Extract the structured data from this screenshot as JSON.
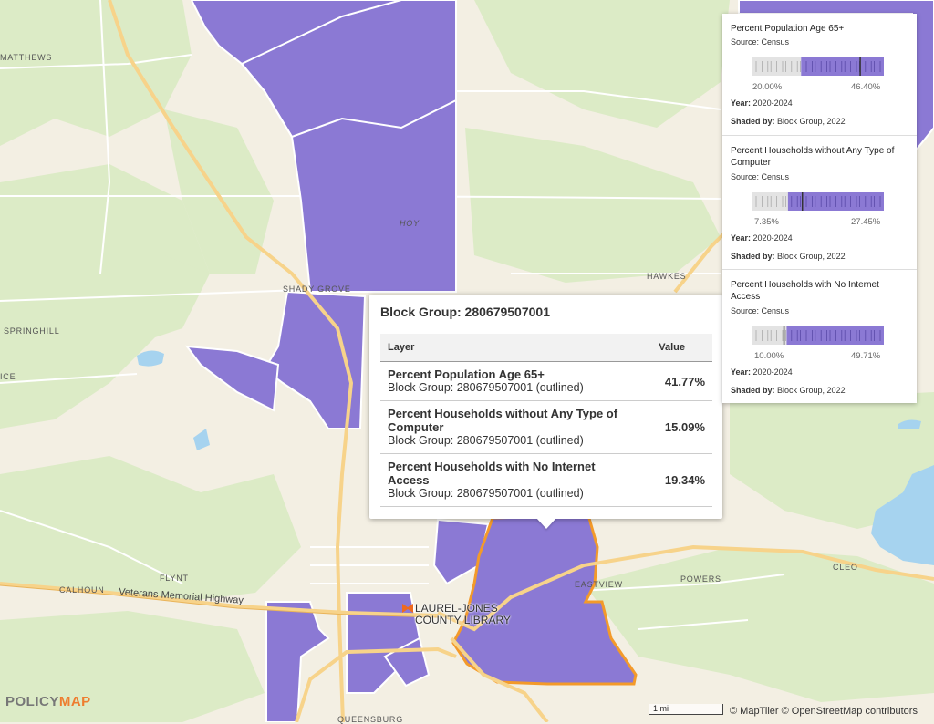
{
  "map": {
    "place_labels": [
      {
        "id": "matthews",
        "text": "MATTHEWS"
      },
      {
        "id": "springhill",
        "text": "SPRINGHILL"
      },
      {
        "id": "ice",
        "text": "ICE"
      },
      {
        "id": "shady-grove",
        "text": "SHADY GROVE"
      },
      {
        "id": "hoy",
        "text": "HOY"
      },
      {
        "id": "hawkes",
        "text": "HAWKES"
      },
      {
        "id": "flynt",
        "text": "FLYNT"
      },
      {
        "id": "calhoun",
        "text": "CALHOUN"
      },
      {
        "id": "eastview",
        "text": "EASTVIEW"
      },
      {
        "id": "powers",
        "text": "POWERS"
      },
      {
        "id": "cleo",
        "text": "CLEO"
      },
      {
        "id": "queensburg",
        "text": "QUEENSBURG"
      }
    ],
    "road_label": "Veterans Memorial Highway",
    "library_label_line1": "LAUREL-JONES",
    "library_label_line2": "COUNTY LIBRARY",
    "colors": {
      "shade": "#8b79d4",
      "outline": "#f39a2a",
      "road": "#f7d38a",
      "green": "#dcebc6",
      "water": "#a6d3ef"
    }
  },
  "popup": {
    "title": "Block Group: 280679507001",
    "col_layer": "Layer",
    "col_value": "Value",
    "rows": [
      {
        "layer": "Percent Population Age 65+",
        "sub": "Block Group: 280679507001 (outlined)",
        "value": "41.77%"
      },
      {
        "layer": "Percent Households without Any Type of Computer",
        "sub": "Block Group: 280679507001 (outlined)",
        "value": "15.09%"
      },
      {
        "layer": "Percent Households with No Internet Access",
        "sub": "Block Group: 280679507001 (outlined)",
        "value": "19.34%"
      }
    ]
  },
  "legend": {
    "sections": [
      {
        "title": "Percent Population Age 65+",
        "source": "Source: Census",
        "min": "20.00%",
        "max": "46.40%",
        "year_label": "Year:",
        "year": "2020-2024",
        "shaded_label": "Shaded by:",
        "shaded": "Block Group, 2022",
        "shade_start_fraction": 0.37,
        "marker_fraction": 0.82
      },
      {
        "title": "Percent Households without Any Type of Computer",
        "source": "Source: Census",
        "min": "7.35%",
        "max": "27.45%",
        "year_label": "Year:",
        "year": "2020-2024",
        "shaded_label": "Shaded by:",
        "shaded": "Block Group, 2022",
        "shade_start_fraction": 0.27,
        "marker_fraction": 0.38
      },
      {
        "title": "Percent Households with No Internet Access",
        "source": "Source: Census",
        "min": "10.00%",
        "max": "49.71%",
        "year_label": "Year:",
        "year": "2020-2024",
        "shaded_label": "Shaded by:",
        "shaded": "Block Group, 2022",
        "shade_start_fraction": 0.26,
        "marker_fraction": 0.24
      }
    ]
  },
  "logo": {
    "part1": "POLICY",
    "part2": "MAP"
  },
  "scale_label": "1 mi",
  "attribution": "© MapTiler © OpenStreetMap contributors"
}
